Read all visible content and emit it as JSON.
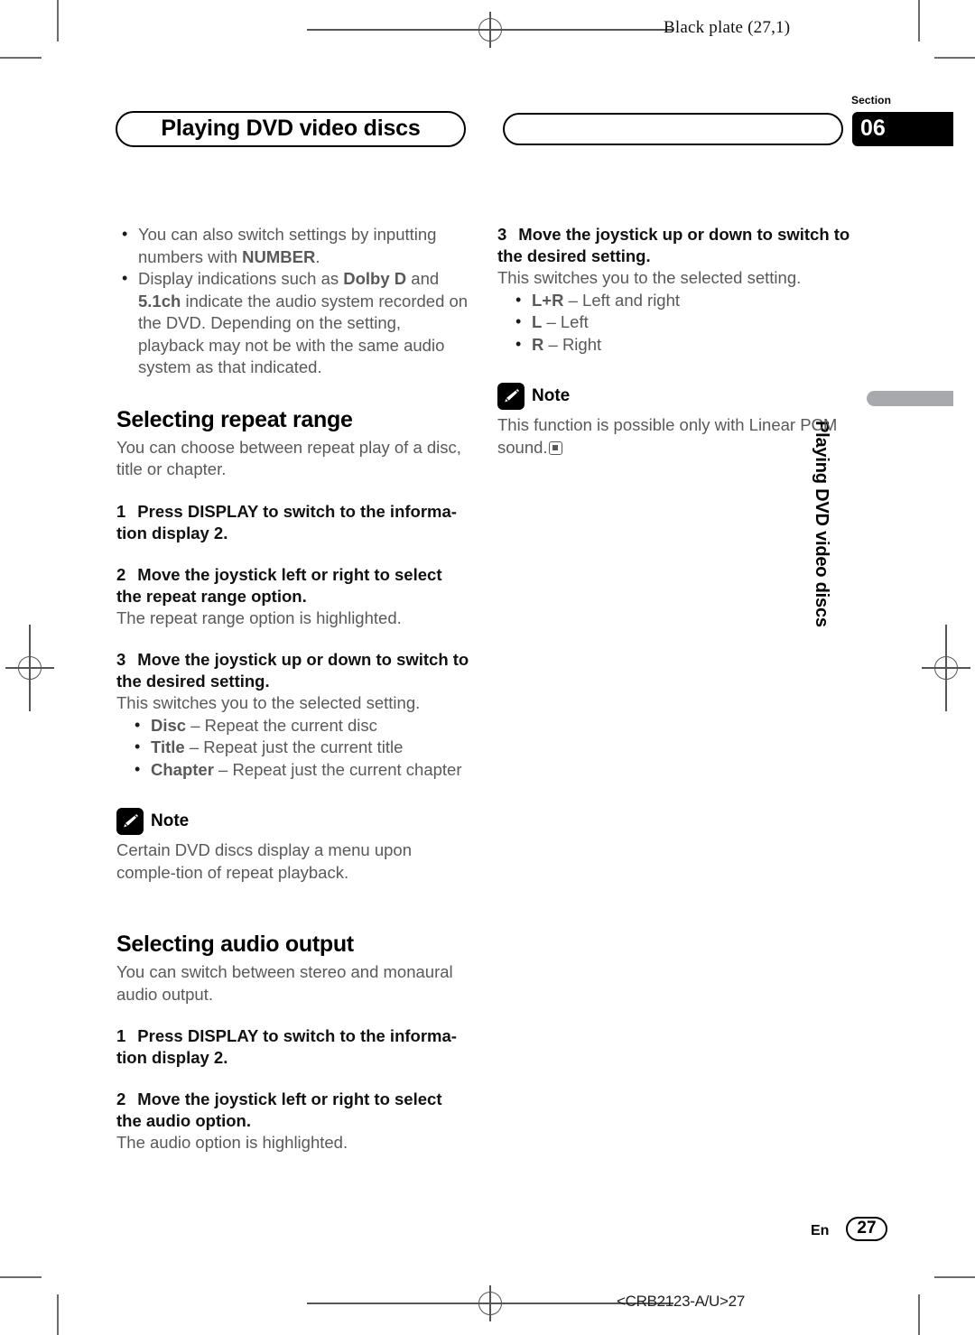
{
  "plate": {
    "label": "Black plate (27,1)"
  },
  "header": {
    "chapter_title": "Playing DVD video discs",
    "section_word": "Section",
    "section_number": "06"
  },
  "side_tab": {
    "text": "Playing DVD video discs",
    "color": "#a7a9ac"
  },
  "left_column": {
    "intro_bullets": [
      "You can also switch settings by inputting numbers with <b>NUMBER</b>.",
      "Display indications such as <b>Dolby D</b> and <b>5.1ch</b> indicate the audio system recorded on the DVD. Depending on the setting, playback may not be with the same audio system as that indicated."
    ],
    "section1": {
      "heading": "Selecting repeat range",
      "intro": "You can choose between repeat play of a disc, title or chapter.",
      "steps": [
        {
          "number": "1",
          "text": "Press DISPLAY to switch to the informa-tion display 2.",
          "sub": ""
        },
        {
          "number": "2",
          "text": "Move the joystick left or right to select the repeat range option.",
          "sub": "The repeat range option is highlighted."
        },
        {
          "number": "3",
          "text": "Move the joystick up or down to switch to the desired setting.",
          "sub": "This switches you to the selected setting."
        }
      ],
      "options": [
        "<b>Disc</b> – Repeat the current disc",
        "<b>Title</b> – Repeat just the current title",
        "<b>Chapter</b> – Repeat just the current chapter"
      ],
      "note": {
        "icon": "pencil-icon",
        "label": "Note",
        "text": "Certain DVD discs display a menu upon comple-tion of repeat playback."
      }
    },
    "section2": {
      "heading": "Selecting audio output",
      "intro": "You can switch between stereo and monaural audio output.",
      "steps": [
        {
          "number": "1",
          "text": "Press DISPLAY to switch to the informa-tion display 2.",
          "sub": ""
        },
        {
          "number": "2",
          "text": "Move the joystick left or right to select the audio option.",
          "sub": "The audio option is highlighted."
        }
      ]
    }
  },
  "right_column": {
    "step": {
      "number": "3",
      "text": "Move the joystick up or down to switch to the desired setting.",
      "sub": "This switches you to the selected setting."
    },
    "options": [
      "<b>L+R</b> – Left and right",
      "<b>L</b> – Left",
      "<b>R</b> – Right"
    ],
    "note": {
      "icon": "pencil-icon",
      "label": "Note",
      "text": "This function is possible only with Linear PCM sound."
    }
  },
  "footer": {
    "language": "En",
    "page_number": "27",
    "code": "<CRB2123-A/U>27"
  }
}
